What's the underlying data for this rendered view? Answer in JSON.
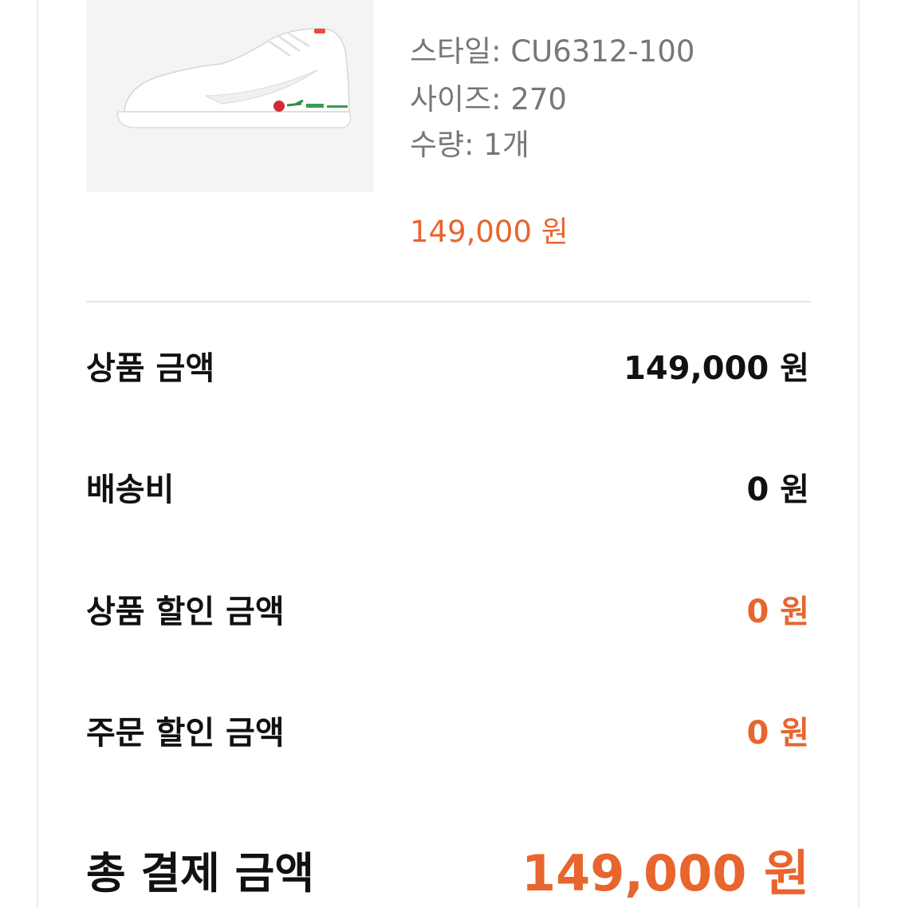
{
  "product": {
    "image_alt": "white sneaker with red rose embroidery",
    "style_label": "스타일: CU6312-100",
    "size_label": "사이즈: 270",
    "quantity_label": "수량: 1개",
    "price": "149,000 원"
  },
  "summary": {
    "rows": [
      {
        "label": "상품 금액",
        "value": "149,000 원",
        "accent": false
      },
      {
        "label": "배송비",
        "value": "0 원",
        "accent": false
      },
      {
        "label": "상품 할인 금액",
        "value": "0 원",
        "accent": true
      },
      {
        "label": "주문 할인 금액",
        "value": "0 원",
        "accent": true
      }
    ],
    "total_label": "총 결제 금액",
    "total_value": "149,000 원"
  },
  "colors": {
    "accent": "#e8652e",
    "text": "#111111",
    "muted": "#777777",
    "divider": "#e6e6e6"
  }
}
